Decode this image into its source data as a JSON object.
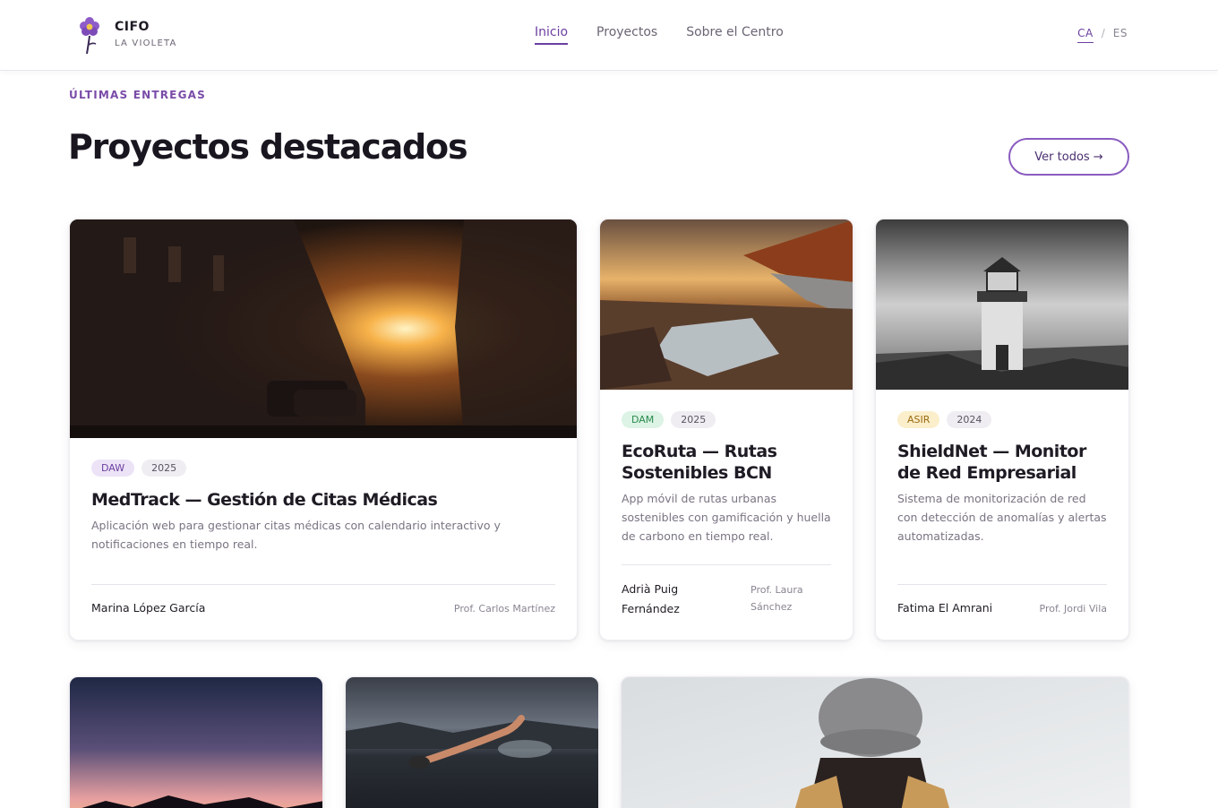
{
  "header": {
    "logo_title": "CIFO",
    "logo_subtitle": "LA VIOLETA",
    "nav": [
      {
        "label": "Inicio"
      },
      {
        "label": "Proyectos"
      },
      {
        "label": "Sobre el Centro"
      }
    ],
    "lang": {
      "ca": "CA",
      "sep": "/",
      "es": "ES"
    }
  },
  "section": {
    "eyebrow": "ÚLTIMAS ENTREGAS",
    "title": "Proyectos destacados",
    "view_all": "Ver todos →"
  },
  "cards": [
    {
      "tag": "DAW",
      "year": "2025",
      "title": "MedTrack — Gestión de Citas Médicas",
      "description": "Aplicación web para gestionar citas médicas con calendario interactivo y notificaciones en tiempo real.",
      "author": "Marina López García",
      "teacher": "Prof. Carlos Martínez"
    },
    {
      "tag": "DAM",
      "year": "2025",
      "title": "EcoRuta — Rutas Sostenibles BCN",
      "description": "App móvil de rutas urbanas sostenibles con gamificación y huella de carbono en tiempo real.",
      "author": "Adrià Puig Fernández",
      "teacher": "Prof. Laura Sánchez"
    },
    {
      "tag": "ASIR",
      "year": "2024",
      "title": "ShieldNet — Monitor de Red Empresarial",
      "description": "Sistema de monitorización de red con detección de anomalías y alertas automatizadas.",
      "author": "Fatima El Amrani",
      "teacher": "Prof. Jordi Vila"
    }
  ],
  "colors": {
    "accent": "#6b3fa0",
    "badge_daw": "#ece3f7",
    "badge_dam": "#dcf3e5",
    "badge_asir": "#fbeecb"
  }
}
